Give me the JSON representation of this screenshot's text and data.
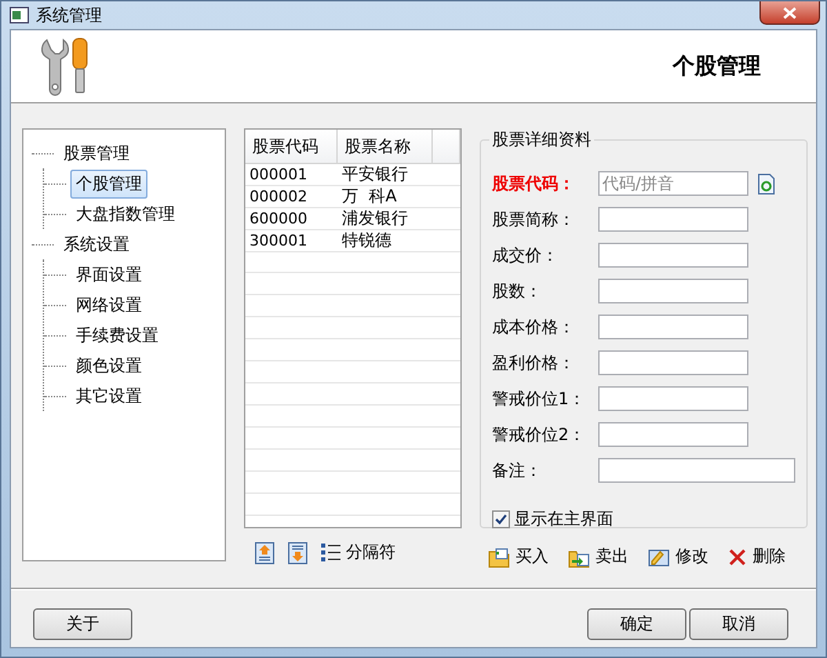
{
  "window": {
    "title": "系统管理"
  },
  "header": {
    "title": "个股管理"
  },
  "tree": [
    {
      "label": "股票管理",
      "selected": false,
      "children": [
        {
          "label": "个股管理",
          "selected": true
        },
        {
          "label": "大盘指数管理",
          "selected": false
        }
      ]
    },
    {
      "label": "系统设置",
      "selected": false,
      "children": [
        {
          "label": "界面设置",
          "selected": false
        },
        {
          "label": "网络设置",
          "selected": false
        },
        {
          "label": "手续费设置",
          "selected": false
        },
        {
          "label": "颜色设置",
          "selected": false
        },
        {
          "label": "其它设置",
          "selected": false
        }
      ]
    }
  ],
  "stock_list": {
    "columns": [
      "股票代码",
      "股票名称"
    ],
    "rows": [
      {
        "code": "000001",
        "name": "平安银行"
      },
      {
        "code": "000002",
        "name": "万  科A"
      },
      {
        "code": "600000",
        "name": "浦发银行"
      },
      {
        "code": "300001",
        "name": "特锐德"
      }
    ],
    "separator_button": "分隔符"
  },
  "details": {
    "title": "股票详细资料",
    "fields": [
      {
        "kind": "code",
        "label": "股票代码：",
        "placeholder": "代码/拼音"
      },
      {
        "kind": "text",
        "label": "股票简称："
      },
      {
        "kind": "text",
        "label": "成交价："
      },
      {
        "kind": "text",
        "label": "股数："
      },
      {
        "kind": "text",
        "label": "成本价格："
      },
      {
        "kind": "text",
        "label": "盈利价格："
      },
      {
        "kind": "text",
        "label": "警戒价位1："
      },
      {
        "kind": "text",
        "label": "警戒价位2："
      },
      {
        "kind": "note",
        "label": "备注："
      }
    ],
    "show_on_main": {
      "label": "显示在主界面",
      "checked": true
    }
  },
  "actions": [
    {
      "kind": "buy",
      "label": "买入"
    },
    {
      "kind": "sell",
      "label": "卖出"
    },
    {
      "kind": "edit",
      "label": "修改"
    },
    {
      "kind": "delete",
      "label": "删除"
    }
  ],
  "footer": {
    "about": "关于",
    "ok": "确定",
    "cancel": "取消"
  }
}
